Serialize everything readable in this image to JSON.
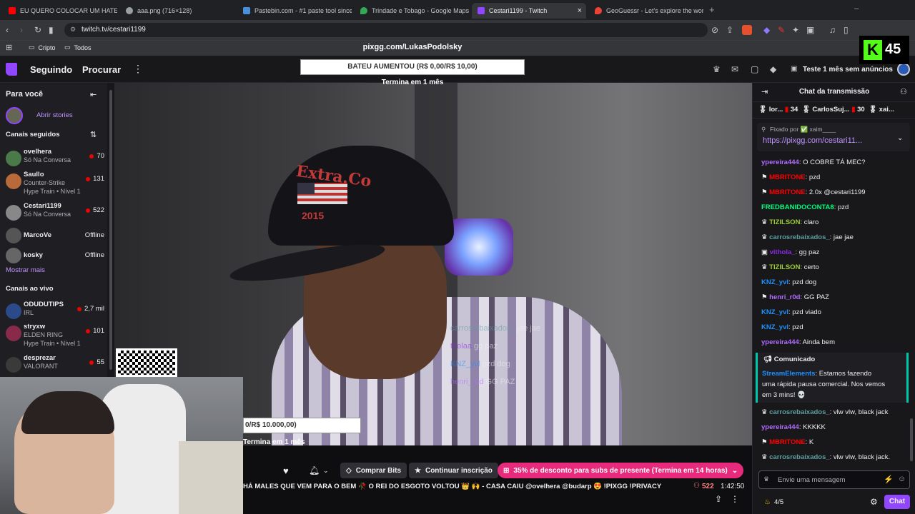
{
  "browser": {
    "tabs": [
      {
        "label": "EU QUERO COLOCAR UM HATER DO",
        "color": "#ff0000"
      },
      {
        "label": "aaa.png (716×128)",
        "color": "#9aa0a6"
      },
      {
        "label": "Pastebin.com - #1 paste tool since 2",
        "color": "#4a90d9"
      },
      {
        "label": "Trindade e Tobago - Google Maps",
        "color": "#34a853"
      },
      {
        "label": "Cestari1199 - Twitch",
        "color": "#9146ff"
      },
      {
        "label": "GeoGuessr - Let's explore the world!",
        "color": "#ea4335"
      }
    ],
    "url": "twitch.tv/cestari1199",
    "bookmarks": [
      "Cripto",
      "Todos"
    ],
    "ext_badge": "45"
  },
  "twitch": {
    "nav": {
      "following": "Seguindo",
      "browse": "Procurar"
    },
    "ad_promo": "Teste 1 mês sem anúncios",
    "sidebar": {
      "for_you": "Para você",
      "stories": "Abrir stories",
      "followed_header": "Canais seguidos",
      "followed": [
        {
          "name": "ovelhera",
          "sub": "Só Na Conversa",
          "viewers": "70",
          "color": "#4a7a4a"
        },
        {
          "name": "Saullo",
          "sub": "Counter-Strike",
          "sub2": "Hype Train • Nível 1",
          "viewers": "131",
          "color": "#b86a3a"
        },
        {
          "name": "Cestari1199",
          "sub": "Só Na Conversa",
          "viewers": "522",
          "color": "#888"
        },
        {
          "name": "MarcoVe",
          "sub": "",
          "viewers": "Offline",
          "color": "#555"
        },
        {
          "name": "kosky",
          "sub": "",
          "viewers": "Offline",
          "color": "#666"
        }
      ],
      "show_more": "Mostrar mais",
      "live_header": "Canais ao vivo",
      "live": [
        {
          "name": "ODUDUTIPS",
          "sub": "IRL",
          "viewers": "2,7 mil",
          "color": "#2a4a8a"
        },
        {
          "name": "stryxw",
          "sub": "ELDEN RING",
          "sub2": "Hype Train • Nível 1",
          "viewers": "101",
          "color": "#8a2a4a"
        },
        {
          "name": "desprezar",
          "sub": "VALORANT",
          "viewers": "55",
          "color": "#3a3a3a"
        }
      ]
    },
    "overlay": {
      "pix_link": "pixgg.com/LukasPodolsky",
      "goal": "BATEU AUMENTOU (R$ 0,00/R$ 10,00)",
      "goal_end": "Termina em 1 mês",
      "goal2": "0/R$ 10.000,00)",
      "goal2_end": "Termina em 1 mês",
      "cap_text": "Extra.Co",
      "cap_year": "2015",
      "ghost_chat": [
        {
          "user": "carrosrebaixados_",
          "text": "jae jae"
        },
        {
          "user": "tholaa",
          "text": "gg paz"
        },
        {
          "user": "KNZ_yvl",
          "text": "pzd dog"
        },
        {
          "user": "henri_r0d",
          "text": "GG PAZ"
        }
      ]
    },
    "controls": {
      "bits": "Comprar Bits",
      "continue_sub": "Continuar inscrição",
      "promo": "35% de desconto para subs de presente (Termina em 14 horas)",
      "ticker": "HÁ MALES QUE VEM PARA O BEM 🥀 O REI DO ESGOTO VOLTOU 👑 🙌 - CASA CAIU @ovelhera @budarp 😍 !PIXGG !PRIVACY",
      "viewers": "522",
      "uptime": "1:42:50"
    },
    "chat": {
      "title": "Chat da transmissão",
      "top_gifters": [
        {
          "name": "lor...",
          "count": "34"
        },
        {
          "name": "CarlosSuj...",
          "count": "30"
        },
        {
          "name": "xai..."
        }
      ],
      "pinned_by": "Fixado por ✅ xaim____",
      "pinned_link": "https://pixgg.com/cestari11...",
      "messages": [
        {
          "user": "ypereira444",
          "color": "#b26cff",
          "text": ": O COBRE TÁ MEC?"
        },
        {
          "user": "MBRITONE",
          "color": "#ff0000",
          "text": ": pzd"
        },
        {
          "user": "MBRITONE",
          "color": "#ff0000",
          "text": ": 2.0x @cestari1199"
        },
        {
          "user": "FREDBANIDOCONTA8",
          "color": "#00ff7f",
          "text": ": pzd"
        },
        {
          "user": "TIZILSON",
          "color": "#9acd32",
          "text": ": claro"
        },
        {
          "user": "carrosrebaixados_",
          "color": "#5f9ea0",
          "text": ": jae jae"
        },
        {
          "user": "vithola_",
          "color": "#8a2be2",
          "text": ": gg paz"
        },
        {
          "user": "TIZILSON",
          "color": "#9acd32",
          "text": ": certo"
        },
        {
          "user": "KNZ_yvl",
          "color": "#1e90ff",
          "text": ": pzd dog"
        },
        {
          "user": "henri_r0d",
          "color": "#b26cff",
          "text": ": GG PAZ"
        },
        {
          "user": "KNZ_yvl",
          "color": "#1e90ff",
          "text": ": pzd viado"
        },
        {
          "user": "KNZ_yvl",
          "color": "#1e90ff",
          "text": ": pzd"
        },
        {
          "user": "ypereira444",
          "color": "#b26cff",
          "text": ": Ainda bem"
        }
      ],
      "announcement_label": "Comunicado",
      "announcement_user": "StreamElements",
      "announcement_text": ": Estamos fazendo",
      "announcement_text2": "uma rápida pausa comercial. Nos vemos",
      "announcement_text3": "em 3 mins! 💀",
      "messages2": [
        {
          "user": "carrosrebaixados_",
          "color": "#5f9ea0",
          "text": ": vlw vlw, black jack"
        },
        {
          "user": "ypereira444",
          "color": "#b26cff",
          "text": ": KKKKK"
        },
        {
          "user": "MBRITONE",
          "color": "#ff0000",
          "text": ": K"
        },
        {
          "user": "carrosrebaixados_",
          "color": "#5f9ea0",
          "text": ": vlw vlw, black jack."
        }
      ],
      "input_placeholder": "Envie uma mensagem",
      "points": "4/5",
      "send": "Chat"
    }
  }
}
